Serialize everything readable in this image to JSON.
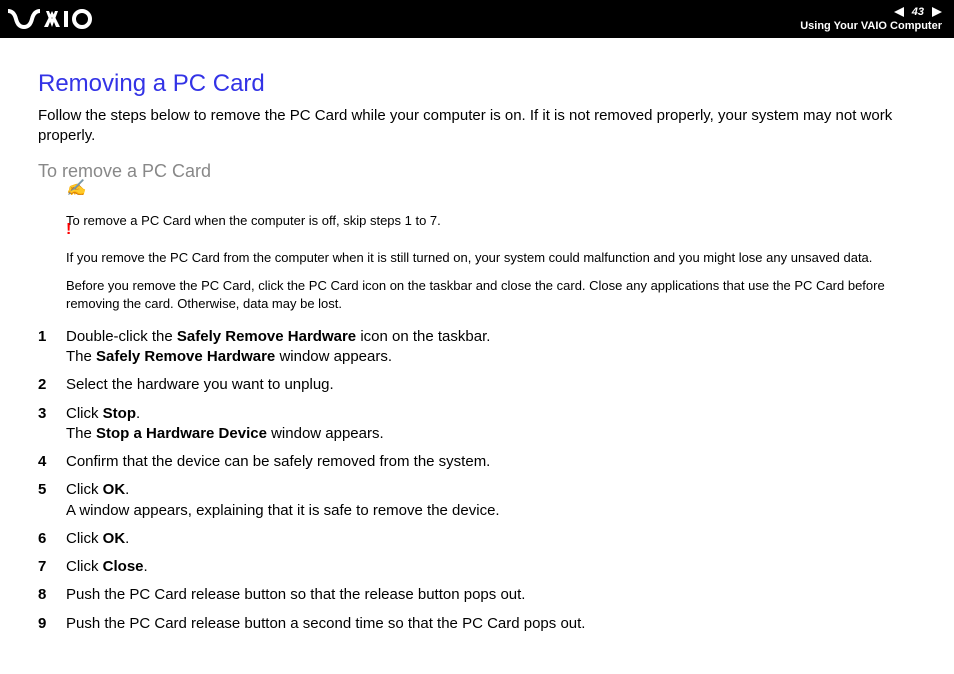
{
  "header": {
    "page_number": "43",
    "section": "Using Your VAIO Computer"
  },
  "content": {
    "heading": "Removing a PC Card",
    "intro": "Follow the steps below to remove the PC Card while your computer is on. If it is not removed properly, your system may not work properly.",
    "subheading": "To remove a PC Card",
    "tip_icon": "✍",
    "tip_text": "To remove a PC Card when the computer is off, skip steps 1 to 7.",
    "warn_icon": "!",
    "warn_text": "If you remove the PC Card from the computer when it is still turned on, your system could malfunction and you might lose any unsaved data.",
    "plain_text": "Before you remove the PC Card, click the PC Card icon on the taskbar and close the card. Close any applications that use the PC Card before removing the card. Otherwise, data may be lost.",
    "steps": [
      {
        "n": "1",
        "a": "Double-click the ",
        "b": "Safely Remove Hardware",
        "c": " icon on the taskbar.",
        "d": "The ",
        "e": "Safely Remove Hardware",
        "f": " window appears."
      },
      {
        "n": "2",
        "a": "Select the hardware you want to unplug.",
        "b": "",
        "c": "",
        "d": "",
        "e": "",
        "f": ""
      },
      {
        "n": "3",
        "a": "Click ",
        "b": "Stop",
        "c": ".",
        "d": "The ",
        "e": "Stop a Hardware Device",
        "f": " window appears."
      },
      {
        "n": "4",
        "a": "Confirm that the device can be safely removed from the system.",
        "b": "",
        "c": "",
        "d": "",
        "e": "",
        "f": ""
      },
      {
        "n": "5",
        "a": "Click ",
        "b": "OK",
        "c": ".",
        "d": "A window appears, explaining that it is safe to remove the device.",
        "e": "",
        "f": ""
      },
      {
        "n": "6",
        "a": "Click ",
        "b": "OK",
        "c": ".",
        "d": "",
        "e": "",
        "f": ""
      },
      {
        "n": "7",
        "a": "Click ",
        "b": "Close",
        "c": ".",
        "d": "",
        "e": "",
        "f": ""
      },
      {
        "n": "8",
        "a": "Push the PC Card release button so that the release button pops out.",
        "b": "",
        "c": "",
        "d": "",
        "e": "",
        "f": ""
      },
      {
        "n": "9",
        "a": "Push the PC Card release button a second time so that the PC Card pops out.",
        "b": "",
        "c": "",
        "d": "",
        "e": "",
        "f": ""
      }
    ]
  }
}
